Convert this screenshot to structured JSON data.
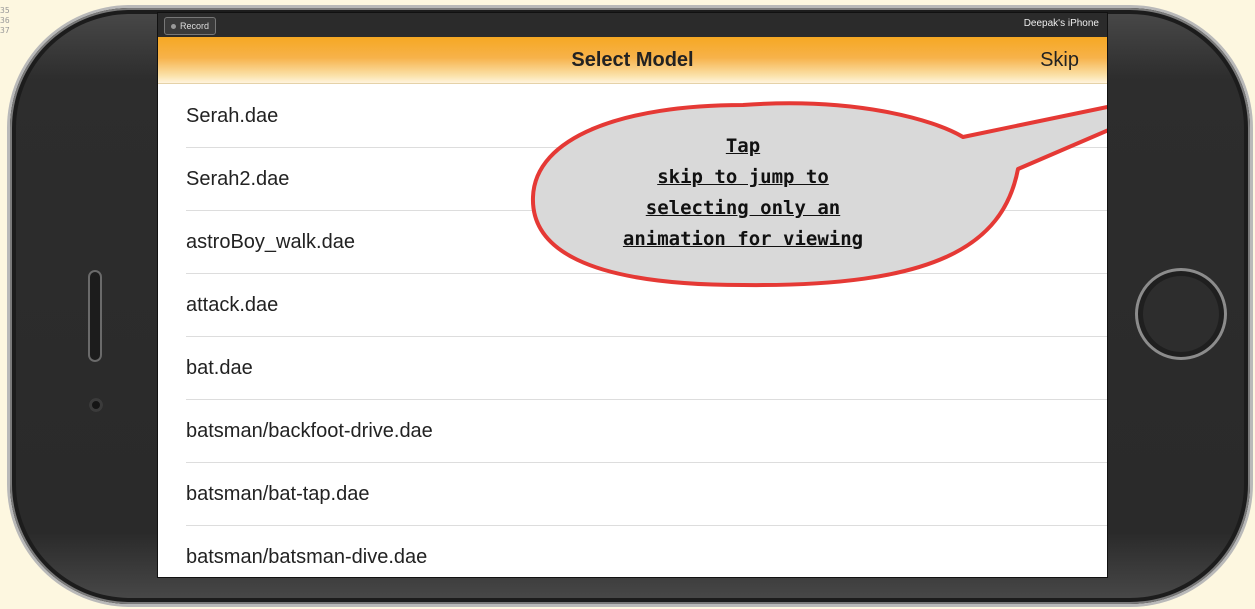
{
  "editor_margin": {
    "line_numbers": [
      "35",
      "36",
      "37"
    ]
  },
  "record_bar": {
    "record_label": "Record",
    "device_name": "Deepak's iPhone"
  },
  "navbar": {
    "title": "Select Model",
    "skip_label": "Skip"
  },
  "models": [
    "Serah.dae",
    "Serah2.dae",
    "astroBoy_walk.dae",
    "attack.dae",
    "bat.dae",
    "batsman/backfoot-drive.dae",
    "batsman/bat-tap.dae",
    "batsman/batsman-dive.dae"
  ],
  "callout": {
    "lines": [
      "Tap",
      "skip to jump to",
      "selecting only an",
      "animation for viewing"
    ]
  },
  "colors": {
    "navbar_orange": "#f6a823",
    "callout_fill": "#d9d9d9",
    "callout_border": "#e53935"
  }
}
